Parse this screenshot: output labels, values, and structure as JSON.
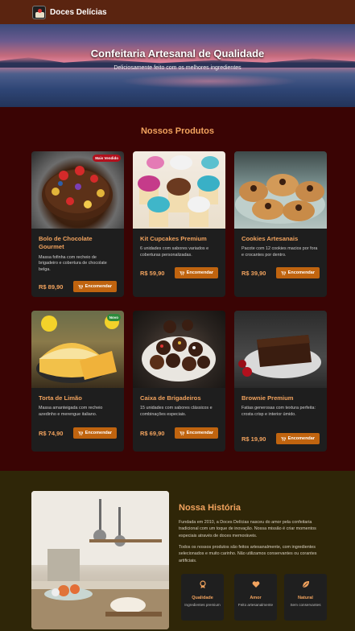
{
  "header": {
    "brand": "Doces Delícias",
    "logo_icon": "cake-logo-icon"
  },
  "hero": {
    "title": "Confeitaria Artesanal de Qualidade",
    "subtitle": "Deliciosamente feito com os melhores ingredientes"
  },
  "products": {
    "title": "Nossos Produtos",
    "button_label": "Encomendar",
    "button_icon": "cart-icon",
    "items": [
      {
        "name": "Bolo de Chocolate Gourmet",
        "desc": "Massa fofinha com recheio de brigadeiro e cobertura de chocolate belga.",
        "price": "R$ 89,90",
        "badge": "Mais Vendido"
      },
      {
        "name": "Kit Cupcakes Premium",
        "desc": "6 unidades com sabores variados e coberturas personalizadas.",
        "price": "R$ 59,90"
      },
      {
        "name": "Cookies Artesanais",
        "desc": "Pacote com 12 cookies macios por fora e crocantes por dentro.",
        "price": "R$ 39,90"
      },
      {
        "name": "Torta de Limão",
        "desc": "Massa amanteigada com recheio azedinho e merengue italiano.",
        "price": "R$ 74,90",
        "badge": "Novo"
      },
      {
        "name": "Caixa de Brigadeiros",
        "desc": "15 unidades com sabores clássicos e combinações especiais.",
        "price": "R$ 69,90"
      },
      {
        "name": "Brownie Premium",
        "desc": "Fatias generosas com textura perfeita: crosta crisp e interior úmido.",
        "price": "R$ 19,90"
      }
    ]
  },
  "story": {
    "title": "Nossa História",
    "p1": "Fundada em 2010, a Doces Delícias nasceu do amor pela confeitaria tradicional com um toque de inovação. Nossa missão é criar momentos especiais através de doces memoráveis.",
    "p2": "Todos os nossos produtos são feitos artesanalmente, com ingredientes selecionados e muito carinho. Não utilizamos conservantes ou corantes artificiais.",
    "features": [
      {
        "title": "Qualidade",
        "sub": "Ingredientes premium",
        "icon": "award-icon"
      },
      {
        "title": "Amor",
        "sub": "Feito artesanalmente",
        "icon": "heart-icon"
      },
      {
        "title": "Natural",
        "sub": "Sem conservantes",
        "icon": "leaf-icon"
      }
    ]
  },
  "colors": {
    "accent": "#f2a35e",
    "button": "#c0640f",
    "header": "#5a2410",
    "products_bg": "#3a0404",
    "story_bg": "#2f2608"
  }
}
